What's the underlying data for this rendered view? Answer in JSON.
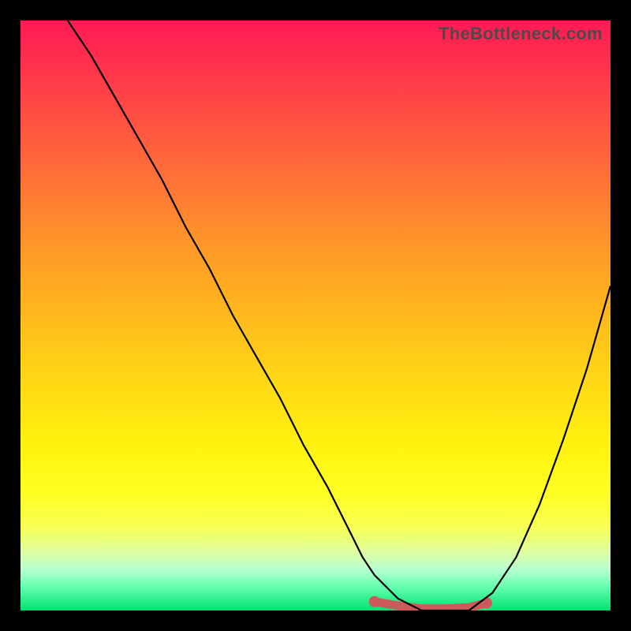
{
  "watermark": "TheBottleneck.com",
  "chart_data": {
    "type": "line",
    "title": "",
    "xlabel": "",
    "ylabel": "",
    "xlim": [
      0,
      100
    ],
    "ylim": [
      0,
      100
    ],
    "series": [
      {
        "name": "bottleneck-curve",
        "x": [
          8,
          12,
          16,
          20,
          24,
          28,
          32,
          36,
          40,
          44,
          48,
          52,
          56,
          58,
          60,
          64,
          68,
          72,
          76,
          80,
          84,
          88,
          92,
          96,
          100
        ],
        "values": [
          100,
          94,
          87,
          80,
          73,
          65,
          58,
          50,
          43,
          36,
          28,
          21,
          13,
          9,
          6,
          2,
          0,
          0,
          0,
          3,
          9,
          18,
          29,
          41,
          55
        ]
      },
      {
        "name": "optimal-band",
        "x": [
          60,
          64,
          68,
          72,
          76,
          79
        ],
        "values": [
          1.5,
          0.8,
          0.3,
          0.3,
          0.5,
          1.3
        ]
      }
    ],
    "colors": {
      "curve": "#000000",
      "optimal_band": "#cc5a5a",
      "gradient_top": "#ff1a55",
      "gradient_bottom": "#00e070"
    },
    "annotations": []
  }
}
